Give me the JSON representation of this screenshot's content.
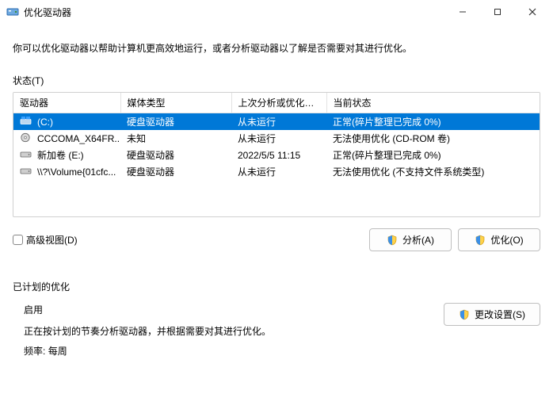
{
  "window": {
    "title": "优化驱动器"
  },
  "description": "你可以优化驱动器以帮助计算机更高效地运行，或者分析驱动器以了解是否需要对其进行优化。",
  "status_label": "状态(T)",
  "table": {
    "columns": {
      "c0": "驱动器",
      "c1": "媒体类型",
      "c2": "上次分析或优化的...",
      "c3": "当前状态"
    },
    "rows": [
      {
        "drive": "(C:)",
        "media": "硬盘驱动器",
        "last": "从未运行",
        "status": "正常(碎片整理已完成 0%)",
        "selected": true,
        "icon": "drive-os"
      },
      {
        "drive": "CCCOMA_X64FR...",
        "media": "未知",
        "last": "从未运行",
        "status": "无法使用优化 (CD-ROM 卷)",
        "selected": false,
        "icon": "disc"
      },
      {
        "drive": "新加卷 (E:)",
        "media": "硬盘驱动器",
        "last": "2022/5/5 11:15",
        "status": "正常(碎片整理已完成 0%)",
        "selected": false,
        "icon": "drive"
      },
      {
        "drive": "\\\\?\\Volume{01cfc...",
        "media": "硬盘驱动器",
        "last": "从未运行",
        "status": "无法使用优化 (不支持文件系统类型)",
        "selected": false,
        "icon": "drive"
      }
    ]
  },
  "advanced_view_label": "高级视图(D)",
  "buttons": {
    "analyze": "分析(A)",
    "optimize": "优化(O)",
    "change_settings": "更改设置(S)"
  },
  "scheduled": {
    "title": "已计划的优化",
    "status": "启用",
    "detail": "正在按计划的节奏分析驱动器，并根据需要对其进行优化。",
    "freq_label": "频率:",
    "freq_value": "每周"
  }
}
